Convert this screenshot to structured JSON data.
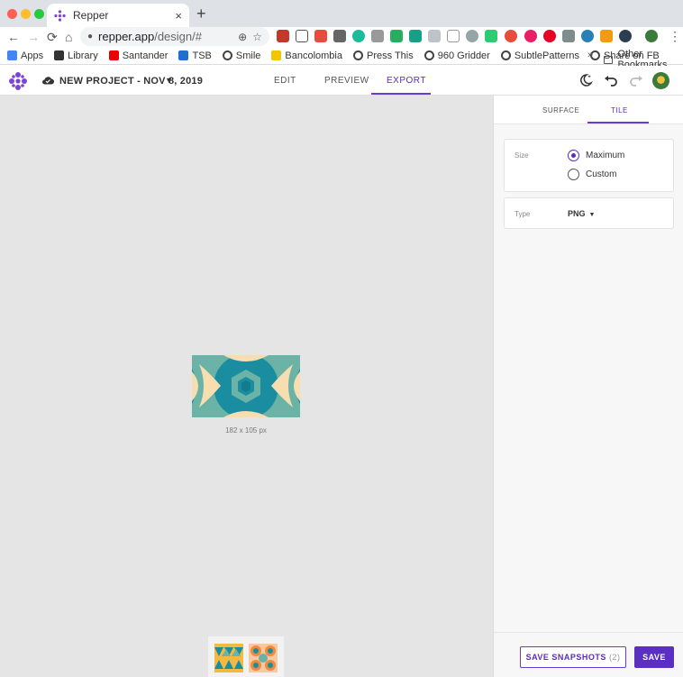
{
  "browser": {
    "tab_title": "Repper",
    "tab_close": "×",
    "new_tab": "+",
    "nav": {
      "back": "←",
      "forward": "→",
      "reload": "⟳",
      "home": "⌂"
    },
    "url_host": "repper.app",
    "url_path": "/design/#",
    "menu": "⋮",
    "bookmarks": [
      {
        "label": "Apps",
        "icon": "apps-grid-icon",
        "color": "#4285f4"
      },
      {
        "label": "Library",
        "icon": "library-icon",
        "color": "#333333"
      },
      {
        "label": "Santander",
        "icon": "santander-icon",
        "color": "#ec0000"
      },
      {
        "label": "TSB",
        "icon": "tsb-icon",
        "color": "#1f6fcf"
      },
      {
        "label": "Smile",
        "icon": "globe-icon"
      },
      {
        "label": "Bancolombia",
        "icon": "bancolombia-icon",
        "color": "#f2c500"
      },
      {
        "label": "Press This",
        "icon": "globe-icon"
      },
      {
        "label": "960 Gridder",
        "icon": "globe-icon"
      },
      {
        "label": "SubtlePatterns",
        "icon": "globe-icon"
      },
      {
        "label": "Share on FB",
        "icon": "globe-icon"
      }
    ],
    "bookmarks_more": "»",
    "other_bookmarks": "Other Bookmarks"
  },
  "app": {
    "project_title": "NEW PROJECT - NOV 8, 2019",
    "tabs": [
      "EDIT",
      "PREVIEW",
      "EXPORT"
    ],
    "active_tab": "EXPORT",
    "accent_color": "#5b2db4"
  },
  "canvas": {
    "tile_size": "182 x 105 px",
    "snapshot_count": 2
  },
  "panel": {
    "tabs": [
      "SURFACE",
      "TILE"
    ],
    "active_tab": "TILE",
    "size_label": "Size",
    "size_options": [
      "Maximum",
      "Custom"
    ],
    "size_selected": "Maximum",
    "type_label": "Type",
    "type_value": "PNG",
    "save_snapshots_label": "SAVE SNAPSHOTS",
    "save_snapshots_count": "(2)",
    "save_label": "SAVE"
  }
}
